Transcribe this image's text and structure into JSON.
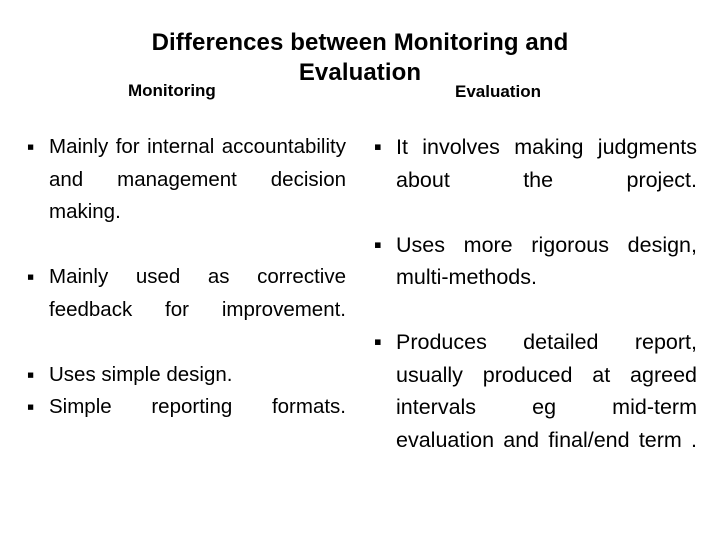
{
  "slide": {
    "background_color": "#ffffff",
    "text_color": "#000000",
    "title": {
      "line1": "Differences between Monitoring and",
      "line2": "Evaluation"
    },
    "columns": {
      "left": {
        "header": "Monitoring",
        "bullet_glyph": "▪",
        "items": [
          "Mainly for internal accountability and management decision making.",
          "Mainly used as corrective feedback for improvement.",
          "Uses simple design.",
          "Simple reporting formats."
        ]
      },
      "right": {
        "header": "Evaluation",
        "bullet_glyph": "▪",
        "items": [
          "It involves making judgments about the project.",
          "Uses more rigorous design, multi-methods.",
          "Produces detailed report, usually produced at agreed intervals eg mid-term evaluation and final/end term ."
        ]
      }
    }
  }
}
